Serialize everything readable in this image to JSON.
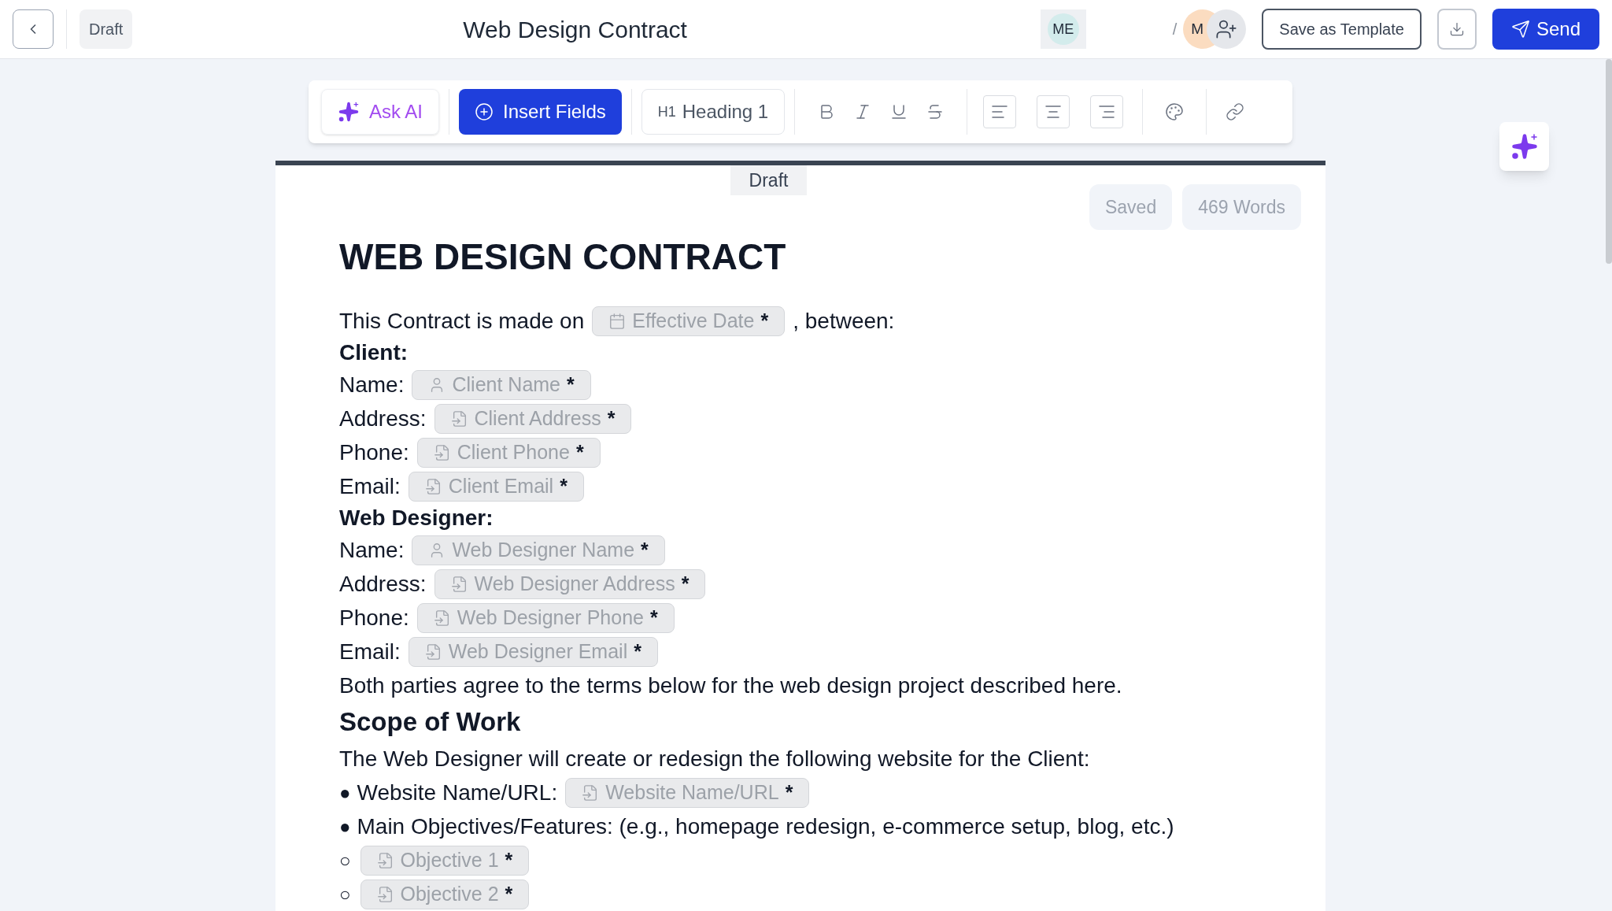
{
  "topbar": {
    "status": "Draft",
    "title": "Web Design Contract",
    "avatars": [
      {
        "initials": "ME",
        "color": "#d3ecec"
      },
      {
        "initials": "M",
        "color": "#fbdcc0"
      }
    ],
    "separator": "/",
    "save_template": "Save as Template",
    "send": "Send"
  },
  "toolbar": {
    "ask_ai": "Ask AI",
    "insert_fields": "Insert Fields",
    "heading": {
      "prefix": "H1",
      "label": "Heading 1"
    }
  },
  "document": {
    "status_tab": "Draft",
    "saved": "Saved",
    "word_count": "469 Words",
    "title": "WEB DESIGN CONTRACT",
    "blocks": [
      {
        "kind": "line",
        "parts": [
          {
            "kind": "text",
            "text": "This Contract is made on"
          },
          {
            "kind": "datefield",
            "label": "Effective Date",
            "mark": "*"
          },
          {
            "kind": "text",
            "text": ", between:"
          }
        ]
      },
      {
        "kind": "label",
        "parts": [
          {
            "kind": "text",
            "text": "Client:"
          }
        ]
      },
      {
        "kind": "line",
        "parts": [
          {
            "kind": "text",
            "text": "Name:"
          },
          {
            "kind": "personfield",
            "label": "Client Name",
            "mark": "*"
          }
        ]
      },
      {
        "kind": "line",
        "parts": [
          {
            "kind": "text",
            "text": "Address:"
          },
          {
            "kind": "filefield",
            "label": "Client Address",
            "mark": "*"
          }
        ]
      },
      {
        "kind": "line",
        "parts": [
          {
            "kind": "text",
            "text": "Phone:"
          },
          {
            "kind": "filefield",
            "label": "Client Phone",
            "mark": "*"
          }
        ]
      },
      {
        "kind": "line",
        "parts": [
          {
            "kind": "text",
            "text": "Email:"
          },
          {
            "kind": "filefield",
            "label": "Client Email",
            "mark": "*"
          }
        ]
      },
      {
        "kind": "label",
        "parts": [
          {
            "kind": "text",
            "text": "Web Designer:"
          }
        ]
      },
      {
        "kind": "line",
        "parts": [
          {
            "kind": "text",
            "text": "Name:"
          },
          {
            "kind": "personfield",
            "label": "Web Designer Name",
            "mark": "*"
          }
        ]
      },
      {
        "kind": "line",
        "parts": [
          {
            "kind": "text",
            "text": "Address:"
          },
          {
            "kind": "filefield",
            "label": "Web Designer Address",
            "mark": "*"
          }
        ]
      },
      {
        "kind": "line",
        "parts": [
          {
            "kind": "text",
            "text": "Phone:"
          },
          {
            "kind": "filefield",
            "label": "Web Designer Phone",
            "mark": "*"
          }
        ]
      },
      {
        "kind": "line",
        "parts": [
          {
            "kind": "text",
            "text": "Email:"
          },
          {
            "kind": "filefield",
            "label": "Web Designer Email",
            "mark": "*"
          }
        ]
      },
      {
        "kind": "line",
        "parts": [
          {
            "kind": "text",
            "text": "Both parties agree to the terms below for the web design project described here."
          }
        ]
      },
      {
        "kind": "heading",
        "parts": [
          {
            "kind": "text",
            "text": "Scope of Work"
          }
        ]
      },
      {
        "kind": "line",
        "parts": [
          {
            "kind": "text",
            "text": "The Web Designer will create or redesign the following website for the Client:"
          }
        ]
      },
      {
        "kind": "line",
        "parts": [
          {
            "kind": "bullet",
            "text": "●"
          },
          {
            "kind": "text",
            "text": "Website Name/URL:"
          },
          {
            "kind": "filefield",
            "label": "Website Name/URL",
            "mark": "*"
          }
        ]
      },
      {
        "kind": "line",
        "parts": [
          {
            "kind": "bullet",
            "text": "●"
          },
          {
            "kind": "text",
            "text": "Main Objectives/Features: (e.g., homepage redesign, e-commerce setup, blog, etc.)"
          }
        ]
      },
      {
        "kind": "line",
        "parts": [
          {
            "kind": "bullet",
            "text": "○"
          },
          {
            "kind": "filefield",
            "label": "Objective 1",
            "mark": "*"
          }
        ]
      },
      {
        "kind": "line",
        "parts": [
          {
            "kind": "bullet",
            "text": "○"
          },
          {
            "kind": "filefield",
            "label": "Objective 2",
            "mark": "*"
          }
        ]
      }
    ]
  }
}
